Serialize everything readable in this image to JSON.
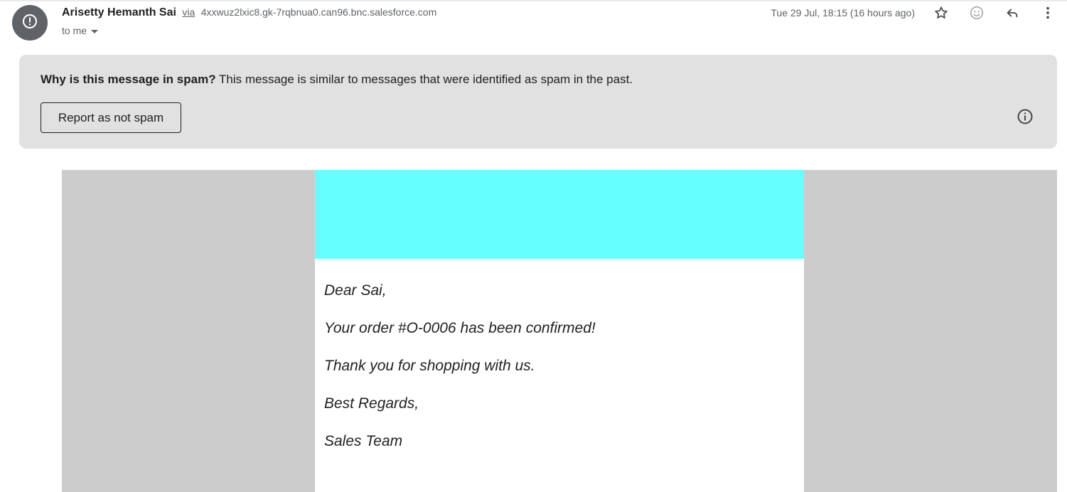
{
  "header": {
    "sender_name": "Arisetty Hemanth Sai",
    "via_label": "via",
    "via_domain": "4xxwuz2lxic8.gk-7rqbnua0.can96.bnc.salesforce.com",
    "recipient_label": "to me",
    "date": "Tue 29 Jul, 18:15 (16 hours ago)",
    "avatar_icon": "warning-icon",
    "actions": [
      "star-icon",
      "emoji-icon",
      "reply-icon",
      "more-vert-icon"
    ]
  },
  "spam_notice": {
    "question": "Why is this message in spam?",
    "explanation": "This message is similar to messages that were identified as spam in the past.",
    "button_label": "Report as not spam",
    "info_icon": "info-icon"
  },
  "email": {
    "banner_color": "#66ffff",
    "frame_color": "#cccccc",
    "lines": [
      "Dear Sai,",
      "Your order #O-0006 has been confirmed!",
      "Thank you for shopping with us.",
      "Best Regards,",
      "Sales Team"
    ]
  }
}
